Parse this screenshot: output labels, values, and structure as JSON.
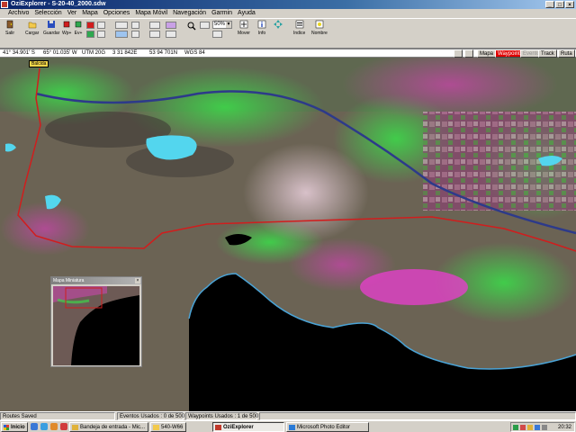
{
  "window": {
    "title": "OziExplorer - S-20-40_2000.sdw",
    "buttons": [
      "_",
      "□",
      "×"
    ]
  },
  "menu": [
    "Archivo",
    "Selección",
    "Ver",
    "Mapa",
    "Opciones",
    "Mapa Móvil",
    "Navegación",
    "Garmin",
    "Ayuda"
  ],
  "toolbar": {
    "salir": "Salir",
    "cargar": "Cargar",
    "guardar": "Guardar",
    "wpt": "Wp+",
    "ev": "Ev+",
    "zoom_value": "50%",
    "mover": "Mover",
    "info": "Info",
    "indice": "Indice",
    "nombre": "Nombre"
  },
  "coords": {
    "lat": "41° 34.901' S",
    "lon": "65° 01.035' W",
    "utm": "UTM  20G",
    "easting": "3 31 842E",
    "northing": "53 94 701N",
    "datum": "WGS 84"
  },
  "modes": {
    "mapa": "Mapa",
    "waypoint": "Waypoint",
    "evento": "Evento",
    "track": "Track",
    "ruta": "Ruta"
  },
  "map": {
    "waypoint_label": "Balcida",
    "colors": {
      "route": "#d11d1d",
      "sea": "#000000",
      "lake": "#53d6ee",
      "vegetation": "#3fd14a",
      "crops": "#b24b96",
      "terrain": "#6b6354"
    }
  },
  "minimap": {
    "title": "Mapa Miniatura",
    "close": "×"
  },
  "status": {
    "left": "Routes Saved",
    "events": "Eventos Usados :  0 de 500",
    "waypoints": "Waypoints Usados :  1 de 500"
  },
  "taskbar": {
    "start": "Inicio",
    "tasks": [
      "Bandeja de entrada - Mic...",
      "540-W66",
      "OziExplorer",
      "Microsoft Photo Editor"
    ],
    "clock": "20:32"
  }
}
